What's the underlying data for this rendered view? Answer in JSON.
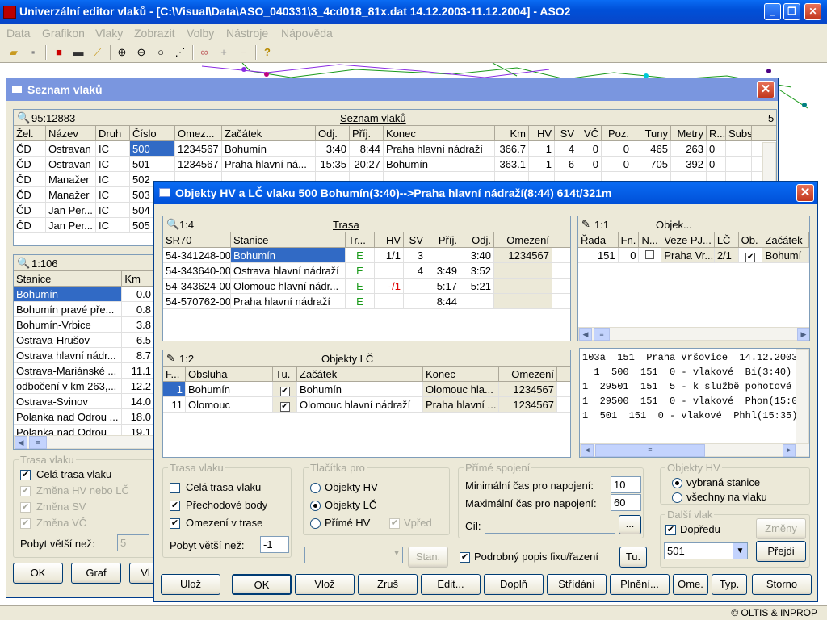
{
  "app": {
    "title": "Univerzální editor vlaků - [C:\\Visual\\Data\\ASO_040331\\3_4cd018_81x.dat 14.12.2003-11.12.2004] - ASO2",
    "menu": [
      "Data",
      "Grafikon",
      "Vlaky",
      "Zobrazit",
      "Volby",
      "Nástroje",
      "Nápověda"
    ],
    "status": "© OLTIS & INPROP"
  },
  "seznam": {
    "title": "Seznam vlaků",
    "count_label": "95:12883",
    "grid_title": "Seznam vlaků",
    "right_num": "5",
    "columns": [
      "Žel.",
      "Název",
      "Druh",
      "Číslo",
      "Omez...",
      "Začátek",
      "Odj.",
      "Příj.",
      "Konec",
      "Km",
      "HV",
      "SV",
      "VČ",
      "Poz.",
      "Tuny",
      "Metry",
      "R...",
      "Subs"
    ],
    "rows": [
      [
        "ČD",
        "Ostravan",
        "IC",
        "500",
        "1234567",
        "Bohumín",
        "3:40",
        "8:44",
        "Praha hlavní nádraží",
        "366.7",
        "1",
        "4",
        "0",
        "0",
        "465",
        "263",
        "0",
        ""
      ],
      [
        "ČD",
        "Ostravan",
        "IC",
        "501",
        "1234567",
        "Praha hlavní ná...",
        "15:35",
        "20:27",
        "Bohumín",
        "363.1",
        "1",
        "6",
        "0",
        "0",
        "705",
        "392",
        "0",
        ""
      ],
      [
        "ČD",
        "Manažer",
        "IC",
        "502",
        "",
        "",
        "",
        "",
        "",
        "",
        "",
        "",
        "",
        "",
        "",
        "",
        "",
        ""
      ],
      [
        "ČD",
        "Manažer",
        "IC",
        "503",
        "",
        "",
        "",
        "",
        "",
        "",
        "",
        "",
        "",
        "",
        "",
        "",
        "",
        ""
      ],
      [
        "ČD",
        "Jan Per...",
        "IC",
        "504",
        "",
        "",
        "",
        "",
        "",
        "",
        "",
        "",
        "",
        "",
        "",
        "",
        "",
        ""
      ],
      [
        "ČD",
        "Jan Per...",
        "IC",
        "505",
        "",
        "",
        "",
        "",
        "",
        "",
        "",
        "",
        "",
        "",
        "",
        "",
        "",
        ""
      ]
    ],
    "stations_label": "1:106",
    "stations_cols": [
      "Stanice",
      "Km"
    ],
    "stations": [
      [
        "Bohumín",
        "0.0"
      ],
      [
        "Bohumín pravé pře...",
        "0.8"
      ],
      [
        "Bohumín-Vrbice",
        "3.8"
      ],
      [
        "Ostrava-Hrušov",
        "6.5"
      ],
      [
        "Ostrava hlavní nádr...",
        "8.7"
      ],
      [
        "Ostrava-Mariánské ...",
        "11.1"
      ],
      [
        "odbočení v km 263,...",
        "12.2"
      ],
      [
        "Ostrava-Svinov",
        "14.0"
      ],
      [
        "Polanka nad Odrou ...",
        "18.0"
      ],
      [
        "Polanka nad Odrou",
        "19.1"
      ]
    ],
    "trasa_group": "Trasa vlaku",
    "chk_cela": "Celá trasa vlaku",
    "chk_zmena_hv": "Změna HV nebo LČ",
    "chk_zmena_sv": "Změna SV",
    "chk_zmena_vc": "Změna VČ",
    "pobyt_label": "Pobyt větší než:",
    "pobyt_value": "5",
    "btn_ok": "OK",
    "btn_graf": "Graf",
    "btn_vl": "Vl"
  },
  "dialog": {
    "title": "Objekty HV a LČ vlaku 500 Bohumín(3:40)-->Praha hlavní nádraží(8:44) 614t/321m",
    "trasa": {
      "count": "1:4",
      "title": "Trasa",
      "columns": [
        "SR70",
        "Stanice",
        "Tr...",
        "HV",
        "SV",
        "Příj.",
        "Odj.",
        "Omezení"
      ],
      "rows": [
        [
          "54-341248-00",
          "Bohumín",
          "E",
          "1/1",
          "3",
          "",
          "3:40",
          "1234567"
        ],
        [
          "54-343640-00",
          "Ostrava hlavní nádraží",
          "E",
          "",
          "4",
          "3:49",
          "3:52",
          ""
        ],
        [
          "54-343624-00",
          "Olomouc hlavní nádr...",
          "E",
          "-/1",
          "",
          "5:17",
          "5:21",
          ""
        ],
        [
          "54-570762-00",
          "Praha hlavní nádraží",
          "E",
          "",
          "",
          "8:44",
          "",
          ""
        ]
      ]
    },
    "objekty": {
      "count": "1:1",
      "title": "Objek...",
      "columns": [
        "Řada",
        "Fn.",
        "N...",
        "Veze PJ...",
        "LČ",
        "Ob.",
        "Začátek"
      ],
      "row": [
        "151",
        "0",
        "",
        "Praha Vr...",
        "2/1",
        "",
        "Bohumí"
      ]
    },
    "lc": {
      "count": "1:2",
      "title": "Objekty LČ",
      "columns": [
        "F...",
        "Obsluha",
        "Tu.",
        "Začátek",
        "Konec",
        "Omezení"
      ],
      "rows": [
        [
          "1",
          "Bohumín",
          "",
          "Bohumín",
          "Olomouc hla...",
          "1234567"
        ],
        [
          "11",
          "Olomouc",
          "",
          "Olomouc hlavní nádraží",
          "Praha hlavní ...",
          "1234567"
        ]
      ]
    },
    "log": [
      "103a  151  Praha Vršovice  14.12.2003  11.12.",
      "  1  500  151  0 - vlakové  Bi(3:40) -> Phhl(8:44",
      "1  29501  151  5 - k službě pohotové  Phhl(9:1",
      "1  29500  151  0 - vlakové  Phon(15:06) -> Phh",
      "1  501  151  0 - vlakové  Phhl(15:35) -> Bi(20:2"
    ],
    "trasa_group": "Trasa vlaku",
    "chk_cela": "Celá trasa vlaku",
    "chk_prechodove": "Přechodové body",
    "chk_omezeni": "Omezení v trase",
    "pobyt_label": "Pobyt větší než:",
    "pobyt_value": "-1",
    "tlacitka_group": "Tlačítka pro",
    "rad_hv": "Objekty HV",
    "rad_lc": "Objekty LČ",
    "rad_prime": "Přímé HV",
    "chk_vpred": "Vpřed",
    "btn_stan": "Stan.",
    "prime_group": "Přímé spojení",
    "min_label": "Minimální čas pro napojení:",
    "min_value": "10",
    "max_label": "Maximální čas pro napojení:",
    "max_value": "60",
    "cil_label": "Cíl:",
    "btn_dots": "...",
    "chk_podrobny": "Podrobný popis fixu/řazení",
    "btn_tu": "Tu.",
    "objhv_group": "Objekty HV",
    "rad_vybrana": "vybraná stanice",
    "rad_vsechny": "všechny na vlaku",
    "dalsi_group": "Další vlak",
    "chk_dopredu": "Dopředu",
    "btn_zmeny": "Změny",
    "next_train": "501",
    "btn_prejdi": "Přejdi",
    "buttons": [
      "Ulož",
      "OK",
      "Vlož",
      "Zruš",
      "Edit...",
      "Doplň",
      "Střídání",
      "Plnění...",
      "Ome.",
      "Typ.",
      "Storno"
    ]
  }
}
